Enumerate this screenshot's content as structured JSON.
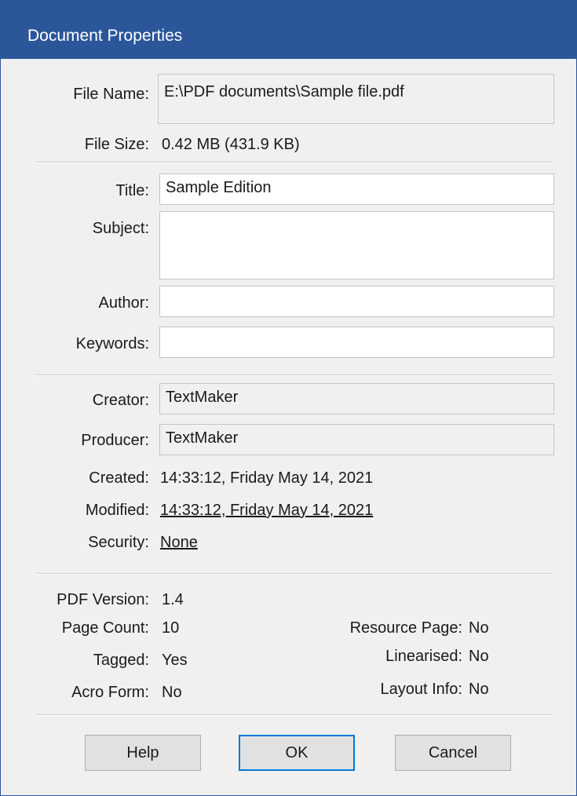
{
  "window": {
    "title": "Document Properties"
  },
  "file": {
    "name_label": "File Name:",
    "name_value": "E:\\PDF documents\\Sample file.pdf",
    "size_label": "File Size:",
    "size_value": "0.42 MB (431.9 KB)"
  },
  "description": {
    "title_label": "Title:",
    "title_value": "Sample Edition",
    "subject_label": "Subject:",
    "subject_value": "",
    "author_label": "Author:",
    "author_value": "",
    "keywords_label": "Keywords:",
    "keywords_value": ""
  },
  "origin": {
    "creator_label": "Creator:",
    "creator_value": "TextMaker",
    "producer_label": "Producer:",
    "producer_value": "TextMaker",
    "created_label": "Created:",
    "created_value": "14:33:12, Friday May 14, 2021",
    "modified_label": "Modified:",
    "modified_value": "14:33:12, Friday May 14, 2021",
    "security_label": "Security:",
    "security_value": "None"
  },
  "pdf_info": {
    "version_label": "PDF Version:",
    "version_value": "1.4",
    "page_count_label": "Page Count:",
    "page_count_value": "10",
    "tagged_label": "Tagged:",
    "tagged_value": "Yes",
    "acro_form_label": "Acro Form:",
    "acro_form_value": "No",
    "resource_page_label": "Resource Page:",
    "resource_page_value": "No",
    "linearised_label": "Linearised:",
    "linearised_value": "No",
    "layout_info_label": "Layout Info:",
    "layout_info_value": "No"
  },
  "buttons": {
    "help": "Help",
    "ok": "OK",
    "cancel": "Cancel"
  },
  "colors": {
    "titlebar": "#2b579a",
    "dialog_bg": "#f0f0f0",
    "focus_border": "#0078d7"
  }
}
